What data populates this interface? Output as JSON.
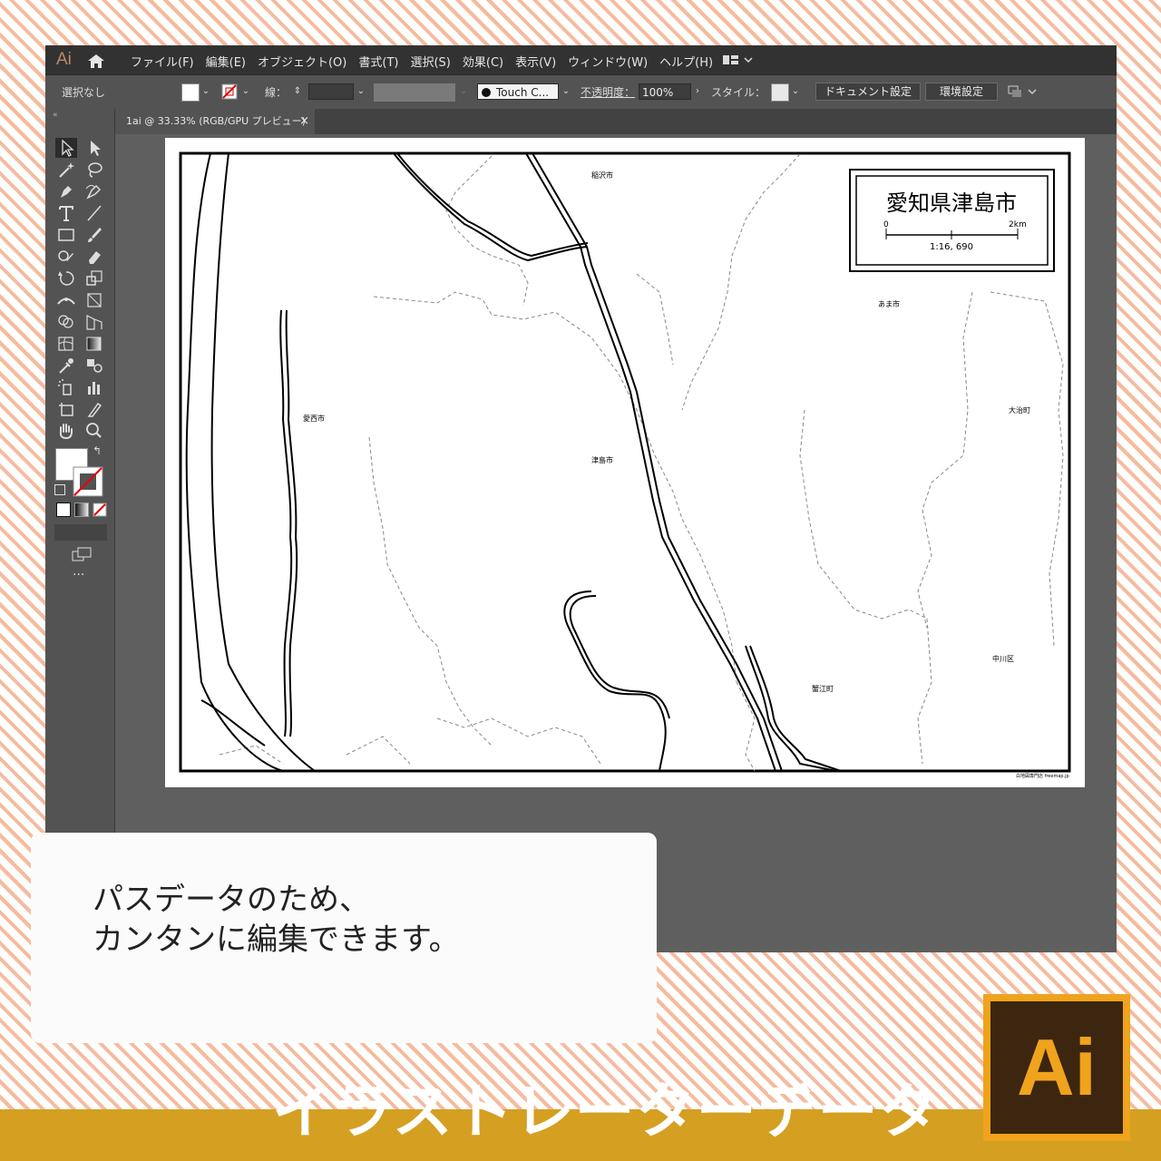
{
  "app": {
    "logo": "Ai",
    "menus": [
      "ファイル(F)",
      "編集(E)",
      "オブジェクト(O)",
      "書式(T)",
      "選択(S)",
      "効果(C)",
      "表示(V)",
      "ウィンドウ(W)",
      "ヘルプ(H)"
    ]
  },
  "control_bar": {
    "selection": "選択なし",
    "stroke_label": "線：",
    "brush": "Touch C...",
    "opacity_label": "不透明度：",
    "opacity": "100%",
    "style_label": "スタイル：",
    "doc_settings": "ドキュメント設定",
    "preferences": "環境設定"
  },
  "tab": {
    "title": "1ai @ 33.33% (RGB/GPU プレビュー)",
    "close": "×"
  },
  "map": {
    "title": "愛知県津島市",
    "scale_start": "0",
    "scale_end": "2km",
    "scale_ratio": "1:16, 690",
    "labels": {
      "inazawa": "稲沢市",
      "ama": "あま市",
      "aisai": "愛西市",
      "oharu": "大治町",
      "tsushima": "津島市",
      "nakagawa": "中川区",
      "kanie": "蟹江町"
    },
    "credit": "白地図専門店 freemap.jp"
  },
  "caption": {
    "line1": "パスデータのため、",
    "line2": "カンタンに編集できます。"
  },
  "banner": {
    "title": "イラストレーターデータ",
    "logo": "Ai"
  },
  "colors": {
    "accent": "#d59f22",
    "logo_bg": "#3d2610",
    "logo_border": "#f0a31c"
  }
}
